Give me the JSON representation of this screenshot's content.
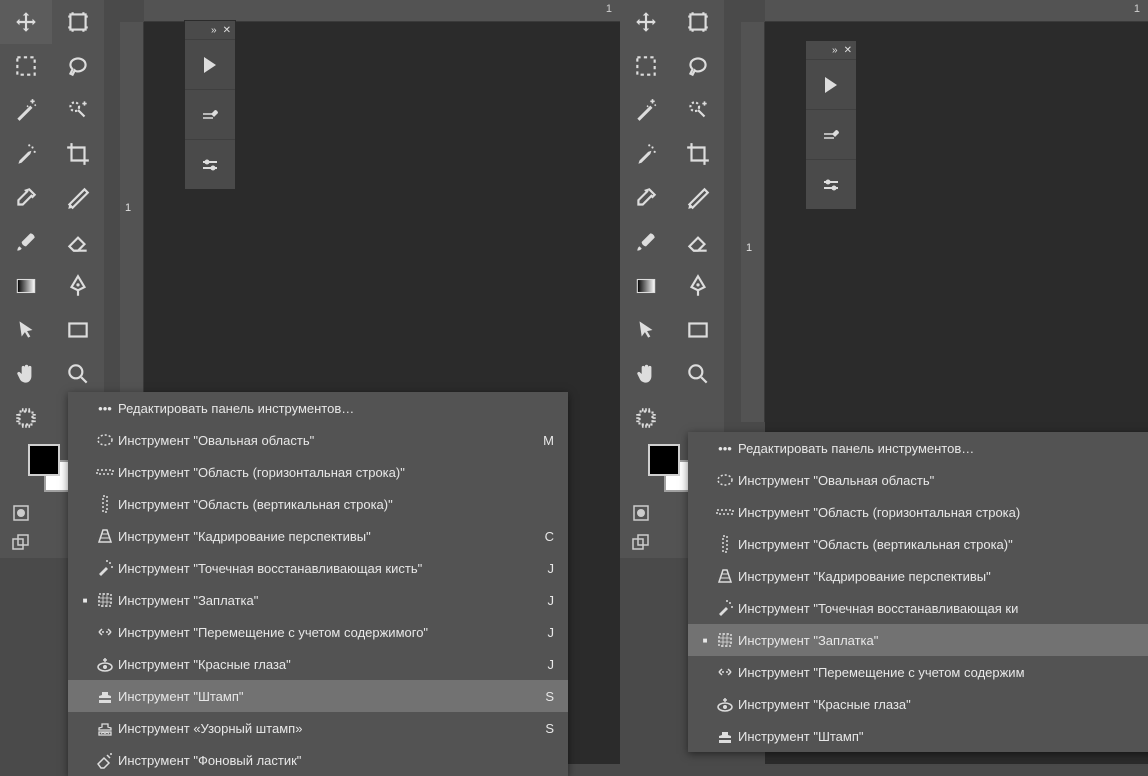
{
  "ruler": {
    "topMark": "1",
    "leftMark": "1"
  },
  "menuHeader": "Редактировать панель инструментов…",
  "itemsLeft": [
    {
      "label": "Инструмент \"Овальная область\"",
      "short": "M",
      "dot": false,
      "icon": "ellipse"
    },
    {
      "label": "Инструмент \"Область (горизонтальная строка)\"",
      "short": "",
      "dot": false,
      "icon": "row"
    },
    {
      "label": "Инструмент \"Область (вертикальная строка)\"",
      "short": "",
      "dot": false,
      "icon": "col"
    },
    {
      "label": "Инструмент \"Кадрирование перспективы\"",
      "short": "C",
      "dot": false,
      "icon": "pcrop"
    },
    {
      "label": "Инструмент \"Точечная восстанавливающая кисть\"",
      "short": "J",
      "dot": false,
      "icon": "spot"
    },
    {
      "label": "Инструмент \"Заплатка\"",
      "short": "J",
      "dot": true,
      "icon": "patch"
    },
    {
      "label": "Инструмент \"Перемещение с учетом содержимого\"",
      "short": "J",
      "dot": false,
      "icon": "camove"
    },
    {
      "label": "Инструмент \"Красные глаза\"",
      "short": "J",
      "dot": false,
      "icon": "redeye"
    },
    {
      "label": "Инструмент \"Штамп\"",
      "short": "S",
      "dot": false,
      "icon": "stamp",
      "hl": true
    },
    {
      "label": "Инструмент «Узорный штамп»",
      "short": "S",
      "dot": false,
      "icon": "pstamp"
    },
    {
      "label": "Инструмент \"Фоновый ластик\"",
      "short": "",
      "dot": false,
      "icon": "beraser"
    }
  ],
  "itemsRight": [
    {
      "label": "Инструмент \"Овальная область\"",
      "short": "",
      "dot": false,
      "icon": "ellipse"
    },
    {
      "label": "Инструмент \"Область (горизонтальная строка)",
      "short": "",
      "dot": false,
      "icon": "row"
    },
    {
      "label": "Инструмент \"Область (вертикальная строка)\"",
      "short": "",
      "dot": false,
      "icon": "col"
    },
    {
      "label": "Инструмент \"Кадрирование перспективы\"",
      "short": "",
      "dot": false,
      "icon": "pcrop"
    },
    {
      "label": "Инструмент \"Точечная восстанавливающая ки",
      "short": "",
      "dot": false,
      "icon": "spot"
    },
    {
      "label": "Инструмент \"Заплатка\"",
      "short": "",
      "dot": true,
      "icon": "patch",
      "hl": true
    },
    {
      "label": "Инструмент \"Перемещение с учетом содержим",
      "short": "",
      "dot": false,
      "icon": "camove"
    },
    {
      "label": "Инструмент \"Красные глаза\"",
      "short": "",
      "dot": false,
      "icon": "redeye"
    },
    {
      "label": "Инструмент \"Штамп\"",
      "short": "",
      "dot": false,
      "icon": "stamp"
    }
  ],
  "toolsGrid": [
    [
      "move",
      "artboard"
    ],
    [
      "marquee",
      "lasso"
    ],
    [
      "wand",
      "quicksel"
    ],
    [
      "heal",
      "crop"
    ],
    [
      "eyedrop",
      "slice"
    ],
    [
      "brush",
      "eraser"
    ],
    [
      "gradient",
      "pen"
    ],
    [
      "pointer",
      "rectangle"
    ],
    [
      "hand",
      "zoom"
    ]
  ]
}
